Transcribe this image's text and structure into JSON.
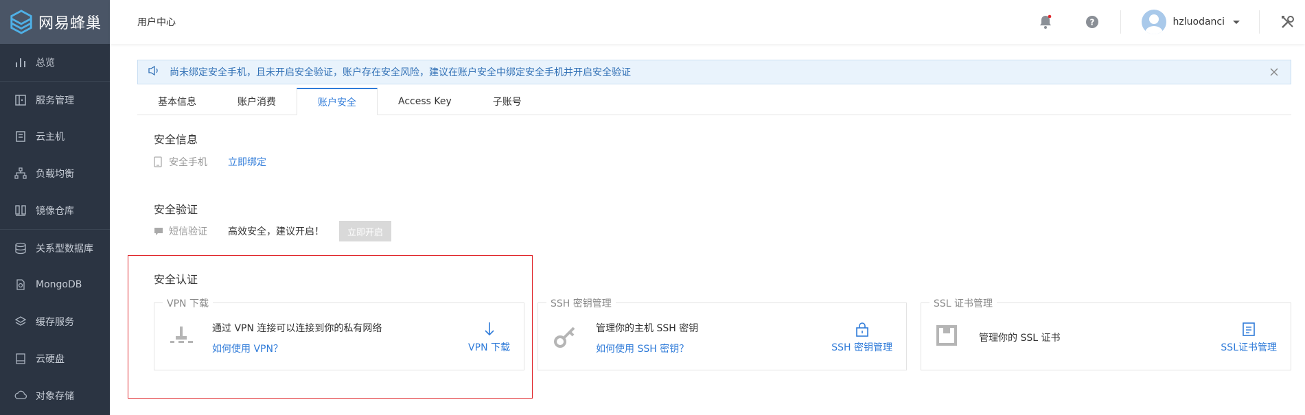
{
  "brand": {
    "name": "网易蜂巢"
  },
  "sidebar": {
    "items": [
      {
        "label": "总览",
        "icon": "bar-chart-icon"
      },
      {
        "label": "服务管理",
        "icon": "service-icon"
      },
      {
        "label": "云主机",
        "icon": "server-icon"
      },
      {
        "label": "负载均衡",
        "icon": "load-balancer-icon"
      },
      {
        "label": "镜像仓库",
        "icon": "image-repo-icon"
      },
      {
        "label": "关系型数据库",
        "icon": "database-icon"
      },
      {
        "label": "MongoDB",
        "icon": "mongodb-icon"
      },
      {
        "label": "缓存服务",
        "icon": "cache-icon"
      },
      {
        "label": "云硬盘",
        "icon": "disk-icon"
      },
      {
        "label": "对象存储",
        "icon": "object-storage-icon"
      }
    ]
  },
  "header": {
    "title": "用户中心",
    "username": "hzluodanci",
    "notification_color": "#e0262b"
  },
  "alert": {
    "text": "尚未绑定安全手机，且未开启安全验证，账户存在安全风险，建议在账户安全中绑定安全手机并开启安全验证"
  },
  "tabs": [
    {
      "label": "基本信息",
      "active": false
    },
    {
      "label": "账户消费",
      "active": false
    },
    {
      "label": "账户安全",
      "active": true
    },
    {
      "label": "Access Key",
      "active": false
    },
    {
      "label": "子账号",
      "active": false
    }
  ],
  "security_info": {
    "title": "安全信息",
    "phone_label": "安全手机",
    "bind_link": "立即绑定"
  },
  "security_verify": {
    "title": "安全验证",
    "sms_label": "短信验证",
    "sms_desc": "高效安全，建议开启！",
    "enable_button": "立即开启"
  },
  "security_auth": {
    "title": "安全认证",
    "cards": [
      {
        "legend": "VPN 下载",
        "desc": "通过 VPN 连接可以连接到你的私有网络",
        "help_link": "如何使用 VPN？",
        "action": "VPN 下载"
      },
      {
        "legend": "SSH 密钥管理",
        "desc": "管理你的主机 SSH 密钥",
        "help_link": "如何使用 SSH 密钥？",
        "action": "SSH 密钥管理"
      },
      {
        "legend": "SSL 证书管理",
        "desc": "管理你的 SSL 证书",
        "help_link": "",
        "action": "SSL证书管理"
      }
    ]
  },
  "colors": {
    "sidebar_bg": "#2b3442",
    "accent": "#2f7bd9",
    "alert_bg": "#e9f3fc",
    "highlight_border": "#e0262b"
  }
}
